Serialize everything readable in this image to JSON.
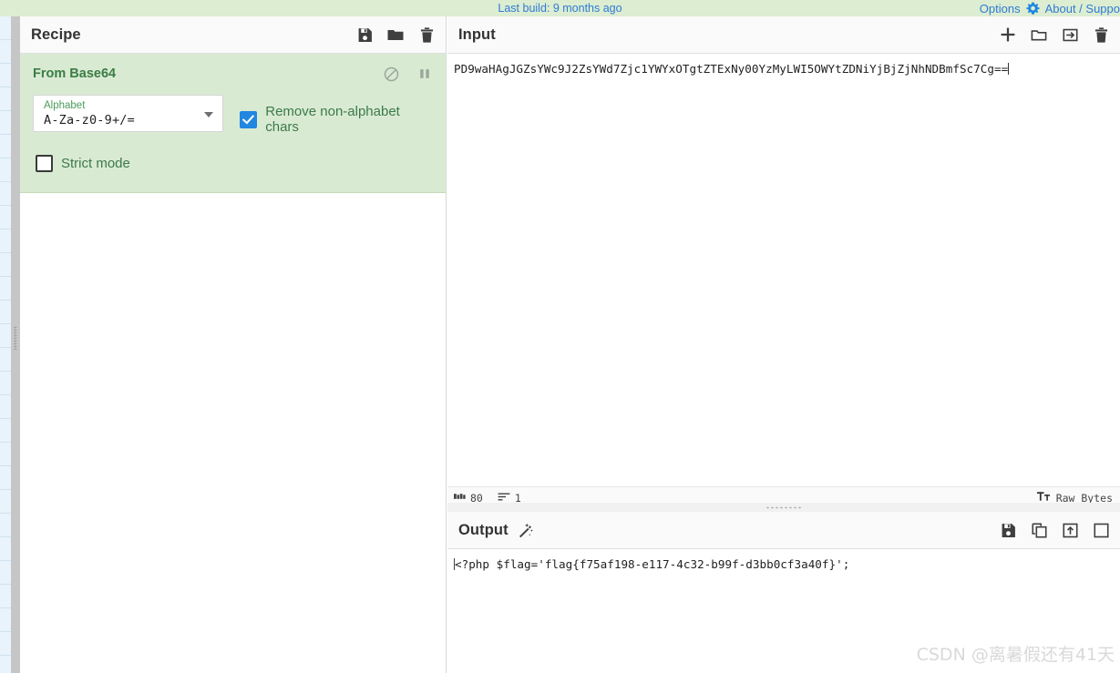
{
  "banner": {
    "build_text": "Last build: 9 months ago",
    "options_label": "Options",
    "about_label": "About / Suppo",
    "gear_icon": "gear-icon",
    "link_color": "#2f7bd4",
    "bg_color": "#dcedd2"
  },
  "recipe": {
    "title": "Recipe",
    "icons": [
      {
        "name": "save-recipe-icon",
        "glyph": "floppy-disk"
      },
      {
        "name": "load-recipe-icon",
        "glyph": "folder"
      },
      {
        "name": "clear-recipe-icon",
        "glyph": "trash"
      }
    ],
    "operation": {
      "name": "From Base64",
      "bg_color": "#d9ead3",
      "title_color": "#3a7d44",
      "disable_icon": "disable-icon",
      "breakpoint_icon": "pause-breakpoint-icon",
      "alphabet": {
        "label": "Alphabet",
        "value": "A-Za-z0-9+/="
      },
      "remove_non_alphabet": {
        "label": "Remove non-alphabet chars",
        "checked": true
      },
      "strict_mode": {
        "label": "Strict mode",
        "checked": false
      }
    }
  },
  "input": {
    "title": "Input",
    "icons": [
      {
        "name": "add-input-tab-icon",
        "glyph": "plus"
      },
      {
        "name": "open-file-icon",
        "glyph": "folder-outline"
      },
      {
        "name": "open-folder-as-input-icon",
        "glyph": "arrow-into-box"
      },
      {
        "name": "clear-input-icon",
        "glyph": "trash"
      }
    ],
    "value": "PD9waHAgJGZsYWc9J2ZsYWd7Zjc1YWYxOTgtZTExNy00YzMyLWI5OWYtZDNiYjBjZjNhNDBmfSc7Cg==",
    "status": {
      "length_icon": "character-count-icon",
      "length": "80",
      "lines_icon": "line-count-icon",
      "lines": "1",
      "encoding_icon": "text-format-icon",
      "encoding": "Raw Bytes"
    }
  },
  "output": {
    "title": "Output",
    "magic_icon": "magic-wand-icon",
    "icons": [
      {
        "name": "save-output-icon",
        "glyph": "floppy-disk"
      },
      {
        "name": "copy-output-icon",
        "glyph": "copy"
      },
      {
        "name": "replace-input-with-output-icon",
        "glyph": "box-arrow-up"
      },
      {
        "name": "maximise-output-icon",
        "glyph": "maximise"
      }
    ],
    "value": "<?php $flag='flag{f75af198-e117-4c32-b99f-d3bb0cf3a40f}';"
  },
  "watermark": {
    "text": "CSDN @离暑假还有41天"
  }
}
